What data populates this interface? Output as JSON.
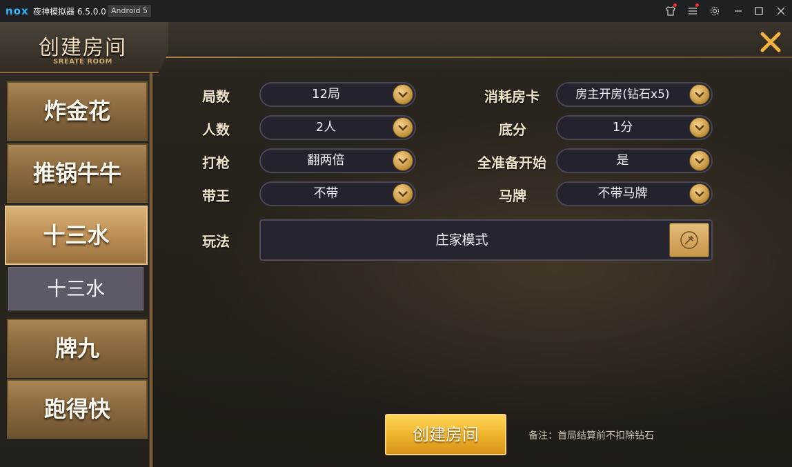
{
  "window": {
    "logo": "nox",
    "title": "夜神模拟器 6.5.0.0",
    "android_badge": "Android 5",
    "icons": [
      "shirt-icon",
      "menu-icon",
      "gear-icon",
      "minimize-icon",
      "maximize-icon",
      "close-icon"
    ]
  },
  "header": {
    "title": "创建房间",
    "subtitle": "SREATE ROOM"
  },
  "sidebar": {
    "tabs": [
      {
        "label": "炸金花",
        "active": false
      },
      {
        "label": "推锅牛牛",
        "active": false
      },
      {
        "label": "十三水",
        "active": true
      },
      {
        "label": "牌九",
        "active": false
      },
      {
        "label": "跑得快",
        "active": false
      }
    ],
    "sub_tab": "十三水"
  },
  "form": {
    "rounds": {
      "label": "局数",
      "value": "12局"
    },
    "players": {
      "label": "人数",
      "value": "2人"
    },
    "shoot": {
      "label": "打枪",
      "value": "翻两倍"
    },
    "joker": {
      "label": "带王",
      "value": "不带"
    },
    "card_cost": {
      "label": "消耗房卡",
      "value": "房主开房(钻石x5)"
    },
    "base_score": {
      "label": "底分",
      "value": "1分"
    },
    "all_ready": {
      "label": "全准备开始",
      "value": "是"
    },
    "horse_card": {
      "label": "马牌",
      "value": "不带马牌"
    },
    "mode": {
      "label": "玩法",
      "value": "庄家模式"
    }
  },
  "footer": {
    "create_button": "创建房间",
    "note": "备注：首局结算前不扣除钻石"
  },
  "colors": {
    "accent_gold": "#f2b43a",
    "button_gold": "#f0b52c",
    "sub_tab": "#5e5867"
  }
}
